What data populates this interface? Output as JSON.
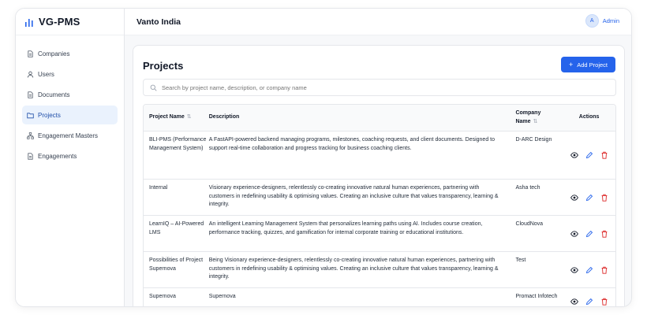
{
  "app": {
    "name": "VG-PMS"
  },
  "sidebar": {
    "items": [
      {
        "label": "Companies",
        "icon": "file-icon"
      },
      {
        "label": "Users",
        "icon": "user-icon"
      },
      {
        "label": "Documents",
        "icon": "file-icon"
      },
      {
        "label": "Projects",
        "icon": "folder-icon",
        "active": true
      },
      {
        "label": "Engagement Masters",
        "icon": "network-icon"
      },
      {
        "label": "Engagements",
        "icon": "file-icon"
      }
    ]
  },
  "header": {
    "org_name": "Vanto India",
    "user_initial": "A",
    "user_name": "Admin"
  },
  "page": {
    "title": "Projects",
    "add_button": "Add Project",
    "search_placeholder": "Search by project name, description, or company name"
  },
  "table": {
    "headers": {
      "name": "Project Name",
      "description": "Description",
      "company": "Company Name",
      "actions": "Actions"
    },
    "rows": [
      {
        "name": "BLI-PMS (Performance Management System)",
        "description": "A FastAPI-powered backend managing programs, milestones, coaching requests, and client documents. Designed to support real-time collaboration and progress tracking for business coaching clients.",
        "company": "D-ARC Design"
      },
      {
        "name": "Internal",
        "description": "Visionary experience-designers, relentlessly co-creating innovative natural human experiences, partnering with customers in redefining usability & optimising values. Creating an inclusive culture that values transparency, learning & integrity.",
        "company": "Asha tech"
      },
      {
        "name": "LearnIQ – AI-Powered LMS",
        "description": "An intelligent Learning Management System that personalizes learning paths using AI. Includes course creation, performance tracking, quizzes, and gamification for internal corporate training or educational institutions.",
        "company": "CloudNova"
      },
      {
        "name": "Possibilities of Project Supernova",
        "description": "Being Visionary experience-designers, relentlessly co-creating innovative natural human experiences, partnering with customers in redefining usability & optimising values. Creating an inclusive culture that values transparency, learning & integrity.",
        "company": "Test"
      },
      {
        "name": "Supernova",
        "description": "Supernova",
        "company": "Promact Infotech"
      }
    ]
  },
  "colors": {
    "primary": "#2563eb",
    "active_bg": "#eaf2fd",
    "delete": "#dc2626"
  }
}
